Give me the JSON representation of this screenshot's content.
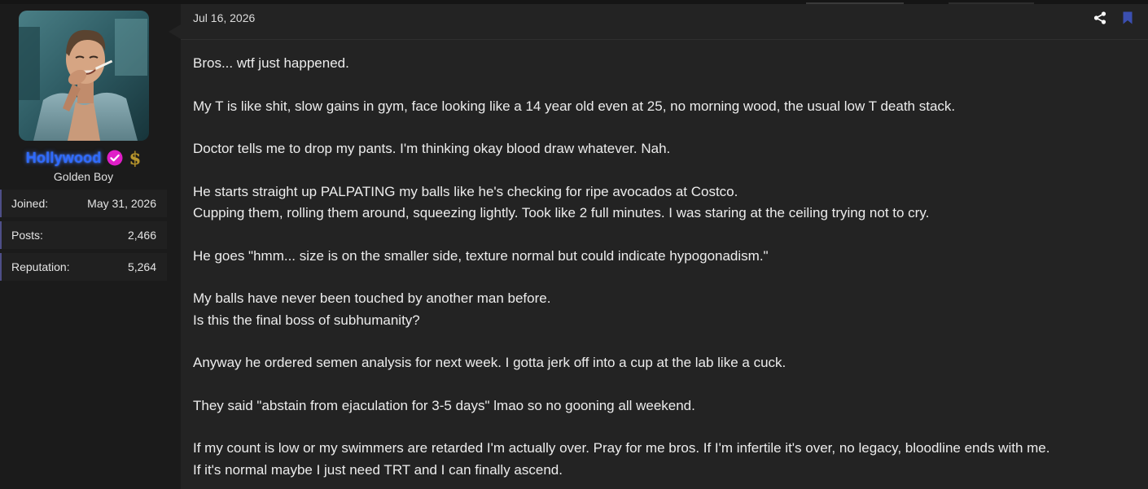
{
  "user": {
    "name": "Hollywood",
    "title": "Golden Boy",
    "stats": [
      {
        "label": "Joined:",
        "value": "May 31, 2026"
      },
      {
        "label": "Posts:",
        "value": "2,466"
      },
      {
        "label": "Reputation:",
        "value": "5,264"
      }
    ],
    "badge_icons": [
      "verified-check-icon",
      "dollar-sign-icon"
    ]
  },
  "post": {
    "date": "Jul 16, 2026",
    "paragraphs": [
      [
        "Bros... wtf just happened."
      ],
      [
        "My T is like shit, slow gains in gym, face looking like a 14 year old even at 25, no morning wood, the usual low T death stack."
      ],
      [
        "Doctor tells me to drop my pants. I'm thinking okay blood draw whatever. Nah."
      ],
      [
        "He starts straight up PALPATING my balls like he's checking for ripe avocados at Costco.",
        "Cupping them, rolling them around, squeezing lightly. Took like 2 full minutes. I was staring at the ceiling trying not to cry."
      ],
      [
        "He goes \"hmm... size is on the smaller side, texture normal but could indicate hypogonadism.\""
      ],
      [
        "My balls have never been touched by another man before.",
        "Is this the final boss of subhumanity?"
      ],
      [
        "Anyway he ordered semen analysis for next week. I gotta jerk off into a cup at the lab like a cuck."
      ],
      [
        "They said \"abstain from ejaculation for 3-5 days\" lmao so no gooning all weekend."
      ],
      [
        "If my count is low or my swimmers are retarded I'm actually over. Pray for me bros. If I'm infertile it's over, no legacy, bloodline ends with me.",
        "If it's normal maybe I just need TRT and I can finally ascend."
      ]
    ]
  },
  "colors": {
    "username": "#2f6bff",
    "verified_badge": "#e01ec8",
    "dollar": "#b8962e",
    "bookmark": "#3b4fb0",
    "stat_border": "#4e4f88"
  }
}
